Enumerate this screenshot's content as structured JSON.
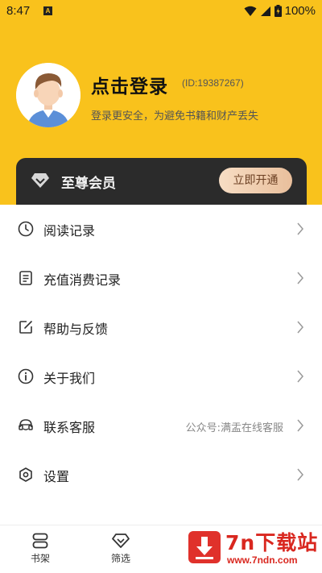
{
  "status_bar": {
    "time": "8:47",
    "notification_icon": "a-box-icon",
    "battery": "100%"
  },
  "profile": {
    "login_title": "点击登录",
    "user_id": "(ID:19387267)",
    "subtitle": "登录更安全，为避免书籍和财产丢失",
    "avatar": "user-avatar-icon"
  },
  "vip": {
    "label": "至尊会员",
    "button": "立即开通",
    "icon": "diamond-icon"
  },
  "menu": {
    "items": [
      {
        "label": "阅读记录",
        "icon": "clock-icon"
      },
      {
        "label": "充值消费记录",
        "icon": "document-icon"
      },
      {
        "label": "帮助与反馈",
        "icon": "edit-icon"
      },
      {
        "label": "关于我们",
        "icon": "info-icon"
      },
      {
        "label": "联系客服",
        "icon": "headset-icon",
        "extra": "公众号:满盂在线客服"
      },
      {
        "label": "设置",
        "icon": "settings-icon"
      }
    ]
  },
  "bottom_nav": {
    "items": [
      {
        "label": "书架",
        "icon": "bookshelf-icon"
      },
      {
        "label": "筛选",
        "icon": "diamond-icon"
      }
    ]
  },
  "watermark": {
    "text": "7n下载站",
    "url": "www.7ndn.com"
  },
  "colors": {
    "header_bg": "#f9c21c",
    "vip_card_bg": "#2b2b2b",
    "vip_button": "#e9bf9c",
    "watermark_red": "#d9271f"
  }
}
